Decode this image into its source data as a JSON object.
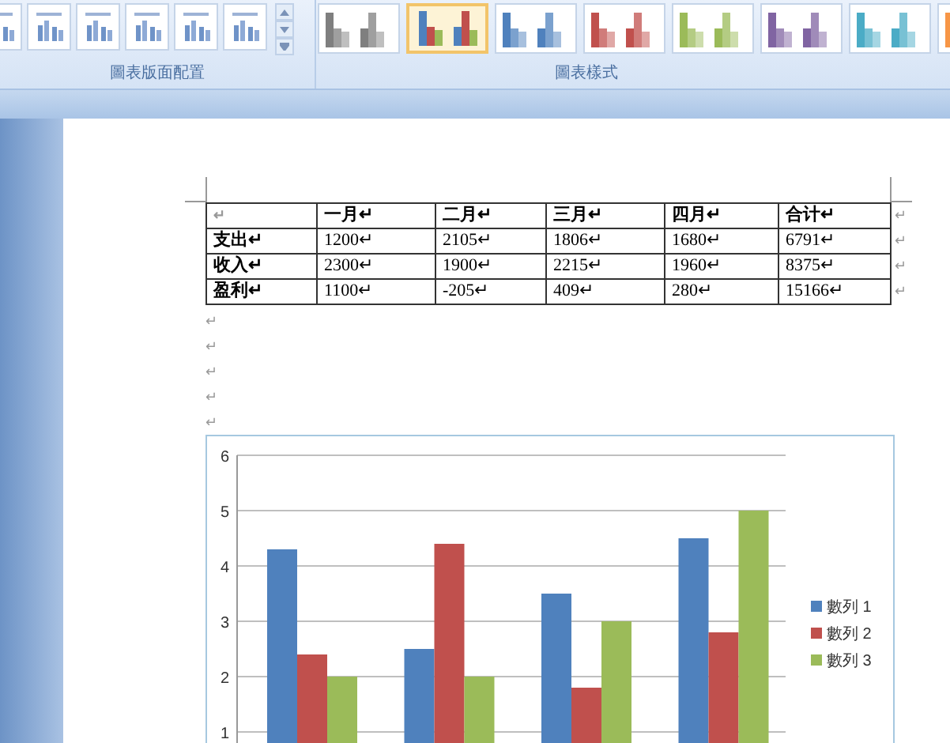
{
  "ribbon": {
    "groups": [
      {
        "label": "圖表版面配置"
      },
      {
        "label": "圖表樣式"
      }
    ],
    "chart_styles": [
      {
        "kind": "mono",
        "color": "#7f7f7f",
        "selected": false
      },
      {
        "kind": "multi",
        "color": "#4f81bd",
        "selected": true
      },
      {
        "kind": "mono",
        "color": "#4f81bd",
        "selected": false
      },
      {
        "kind": "mono",
        "color": "#c0504d",
        "selected": false
      },
      {
        "kind": "mono",
        "color": "#9bbb59",
        "selected": false
      },
      {
        "kind": "mono",
        "color": "#8064a2",
        "selected": false
      },
      {
        "kind": "mono",
        "color": "#4bacc6",
        "selected": false
      },
      {
        "kind": "mono",
        "color": "#f79646",
        "selected": false
      }
    ]
  },
  "document": {
    "table": {
      "rows": [
        [
          "↵",
          "一月↵",
          "二月↵",
          "三月↵",
          "四月↵",
          "合计↵"
        ],
        [
          "支出↵",
          "1200↵",
          "2105↵",
          "1806↵",
          "1680↵",
          "6791↵"
        ],
        [
          "收入↵",
          "2300↵",
          "1900↵",
          "2215↵",
          "1960↵",
          "8375↵"
        ],
        [
          "盈利↵",
          "1100↵",
          "-205↵",
          "409↵",
          "280↵",
          "15166↵"
        ]
      ],
      "row_end_marks": [
        "↵",
        "↵",
        "↵",
        "↵"
      ]
    },
    "empty_paragraphs": [
      "↵",
      "↵",
      "↵",
      "↵",
      "↵"
    ],
    "chart": {
      "chart_data": {
        "type": "bar",
        "yticks": [
          1,
          2,
          3,
          4,
          5,
          6
        ],
        "ylim": [
          0,
          6
        ],
        "grid": true,
        "legend": true,
        "series": [
          {
            "name": "數列 1",
            "color": "#4f81bd",
            "values": [
              4.3,
              2.5,
              3.5,
              4.5
            ]
          },
          {
            "name": "數列 2",
            "color": "#c0504d",
            "values": [
              2.4,
              4.4,
              1.8,
              2.8
            ]
          },
          {
            "name": "數列 3",
            "color": "#9bbb59",
            "values": [
              2,
              2,
              3,
              5
            ]
          }
        ]
      }
    }
  }
}
